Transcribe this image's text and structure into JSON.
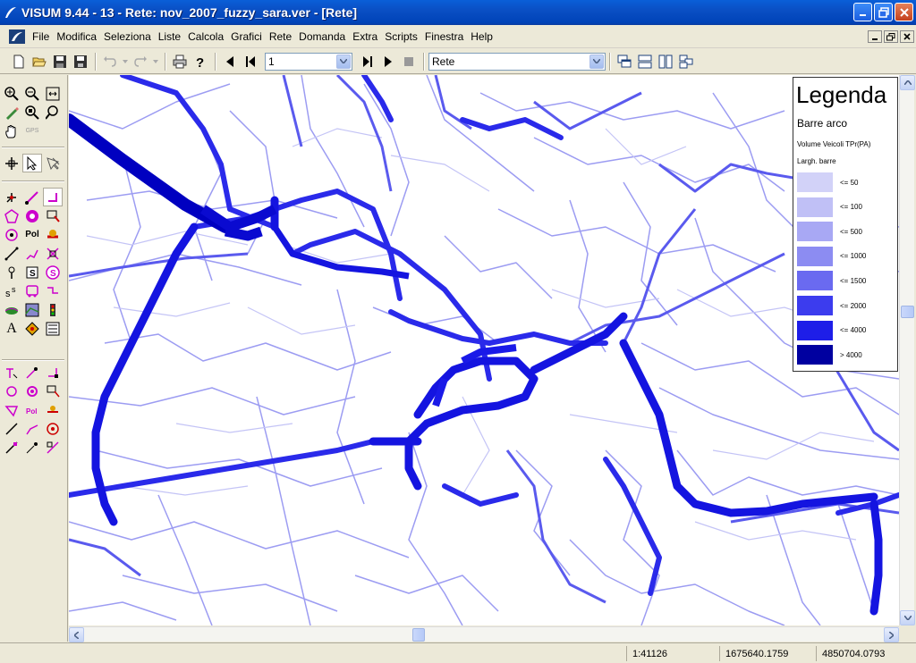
{
  "window": {
    "title": "VISUM 9.44 - 13 - Rete: nov_2007_fuzzy_sara.ver - [Rete]",
    "buttons": [
      "minimize",
      "restore",
      "close"
    ]
  },
  "menu": {
    "items": [
      "File",
      "Modifica",
      "Seleziona",
      "Liste",
      "Calcola",
      "Grafici",
      "Rete",
      "Domanda",
      "Extra",
      "Scripts",
      "Finestra",
      "Help"
    ]
  },
  "toolbar": {
    "page_select_value": "1",
    "view_select_value": "Rete"
  },
  "legend": {
    "title": "Legenda",
    "subtitle": "Barre arco",
    "attribute": "Volume Veicoli TPr(PA)",
    "width_label": "Largh. barre",
    "classes": [
      {
        "label": "<= 50",
        "color": "#d2d2f8"
      },
      {
        "label": "<= 100",
        "color": "#c0c0f6"
      },
      {
        "label": "<= 500",
        "color": "#a8a8f4"
      },
      {
        "label": "<= 1000",
        "color": "#8c8cf2"
      },
      {
        "label": "<= 1500",
        "color": "#6a6af0"
      },
      {
        "label": "<= 2000",
        "color": "#3c3cee"
      },
      {
        "label": "<= 4000",
        "color": "#1e1ee8"
      },
      {
        "label": "> 4000",
        "color": "#0000a0"
      }
    ]
  },
  "palette": {
    "gps_label": "GPS",
    "node_label": "Pol",
    "stop_label": "S",
    "text_label": "A"
  },
  "statusbar": {
    "scale": "1:41126",
    "x": "1675640.1759",
    "y": "4850704.0793"
  }
}
